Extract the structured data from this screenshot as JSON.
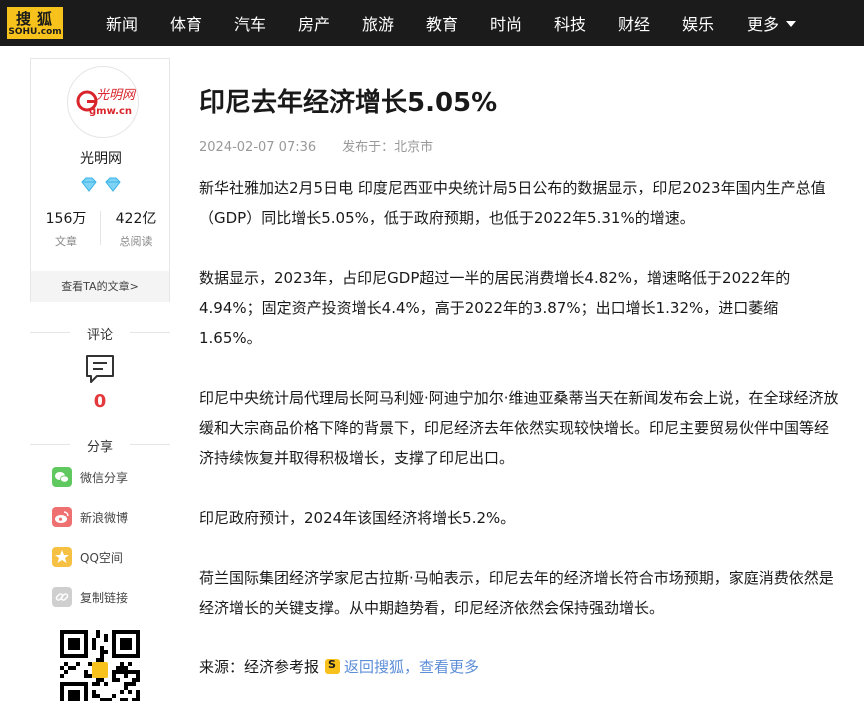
{
  "brand": {
    "logo_cn": "搜狐",
    "logo_en": "SOHU.com"
  },
  "nav": {
    "items": [
      "新闻",
      "体育",
      "汽车",
      "房产",
      "旅游",
      "教育",
      "时尚",
      "科技",
      "财经",
      "娱乐"
    ],
    "more": "更多"
  },
  "author": {
    "logo_text": "光明网",
    "logo_domain": "gmw.cn",
    "name": "光明网",
    "articles_count": "156万",
    "articles_label": "文章",
    "views_count": "422亿",
    "views_label": "总阅读",
    "view_articles": "查看TA的文章>"
  },
  "comments": {
    "title": "评论",
    "count": "0"
  },
  "share": {
    "title": "分享",
    "items": [
      {
        "label": "微信分享",
        "icon": "wechat-icon",
        "color": "#5fc85e"
      },
      {
        "label": "新浪微博",
        "icon": "weibo-icon",
        "color": "#ee7070"
      },
      {
        "label": "QQ空间",
        "icon": "qzone-icon",
        "color": "#f6c142"
      },
      {
        "label": "复制链接",
        "icon": "link-icon",
        "color": "#cfcfcf"
      }
    ]
  },
  "article": {
    "title": "印尼去年经济增长5.05%",
    "date": "2024-02-07 07:36",
    "published_at": "发布于：北京市",
    "paragraphs": [
      "新华社雅加达2月5日电 印度尼西亚中央统计局5日公布的数据显示，印尼2023年国内生产总值（GDP）同比增长5.05%，低于政府预期，也低于2022年5.31%的增速。",
      "数据显示，2023年，占印尼GDP超过一半的居民消费增长4.82%，增速略低于2022年的4.94%；固定资产投资增长4.4%，高于2022年的3.87%；出口增长1.32%，进口萎缩1.65%。",
      "印尼中央统计局代理局长阿马利娅·阿迪宁加尔·维迪亚桑蒂当天在新闻发布会上说，在全球经济放缓和大宗商品价格下降的背景下，印尼经济去年依然实现较快增长。印尼主要贸易伙伴中国等经济持续恢复并取得积极增长，支撑了印尼出口。",
      "印尼政府预计，2024年该国经济将增长5.2%。",
      "荷兰国际集团经济学家尼古拉斯·马帕表示，印尼去年的经济增长符合市场预期，家庭消费依然是经济增长的关键支撑。从中期趋势看，印尼经济依然会保持强劲增长。"
    ],
    "source_label": "来源：经济参考报",
    "back_link": "返回搜狐，查看更多"
  },
  "colors": {
    "nav_bg": "#1b1b1b",
    "brand_yellow": "#f8c21c",
    "comment_red": "#e4393c",
    "link_blue": "#5d8ed8"
  }
}
